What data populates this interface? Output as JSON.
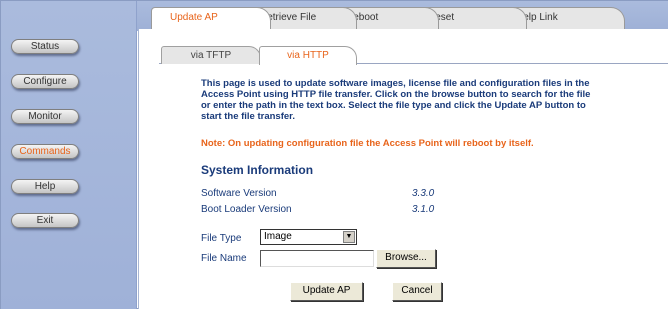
{
  "sidebar": {
    "items": [
      {
        "label": "Status"
      },
      {
        "label": "Configure"
      },
      {
        "label": "Monitor"
      },
      {
        "label": "Commands"
      },
      {
        "label": "Help"
      },
      {
        "label": "Exit"
      }
    ],
    "active_item": "Commands"
  },
  "top_tabs": [
    {
      "label": "Update AP"
    },
    {
      "label": "Retrieve File"
    },
    {
      "label": "Reboot"
    },
    {
      "label": "Reset"
    },
    {
      "label": "Help Link"
    }
  ],
  "sub_tabs": [
    {
      "label": "via TFTP"
    },
    {
      "label": "via HTTP"
    }
  ],
  "description": "This page is used to update software images, license file and configuration files in the Access Point using HTTP file transfer. Click on the browse button to search for the file or enter the path in the text box. Select the file type and click the Update AP button to start the file transfer.",
  "note": "Note: On updating configuration file the Access Point will reboot by itself.",
  "system_info": {
    "title": "System Information",
    "software_version_label": "Software Version",
    "software_version_value": "3.3.0",
    "boot_loader_label": "Boot Loader Version",
    "boot_loader_value": "3.1.0"
  },
  "form": {
    "file_type_label": "File Type",
    "file_type_value": "Image",
    "file_name_label": "File Name",
    "file_name_value": "",
    "browse_label": "Browse...",
    "update_label": "Update AP",
    "cancel_label": "Cancel"
  },
  "colors": {
    "accent": "#e8641b",
    "text_blue": "#1a3b7a",
    "sidebar_bg": "#aabbdd"
  }
}
